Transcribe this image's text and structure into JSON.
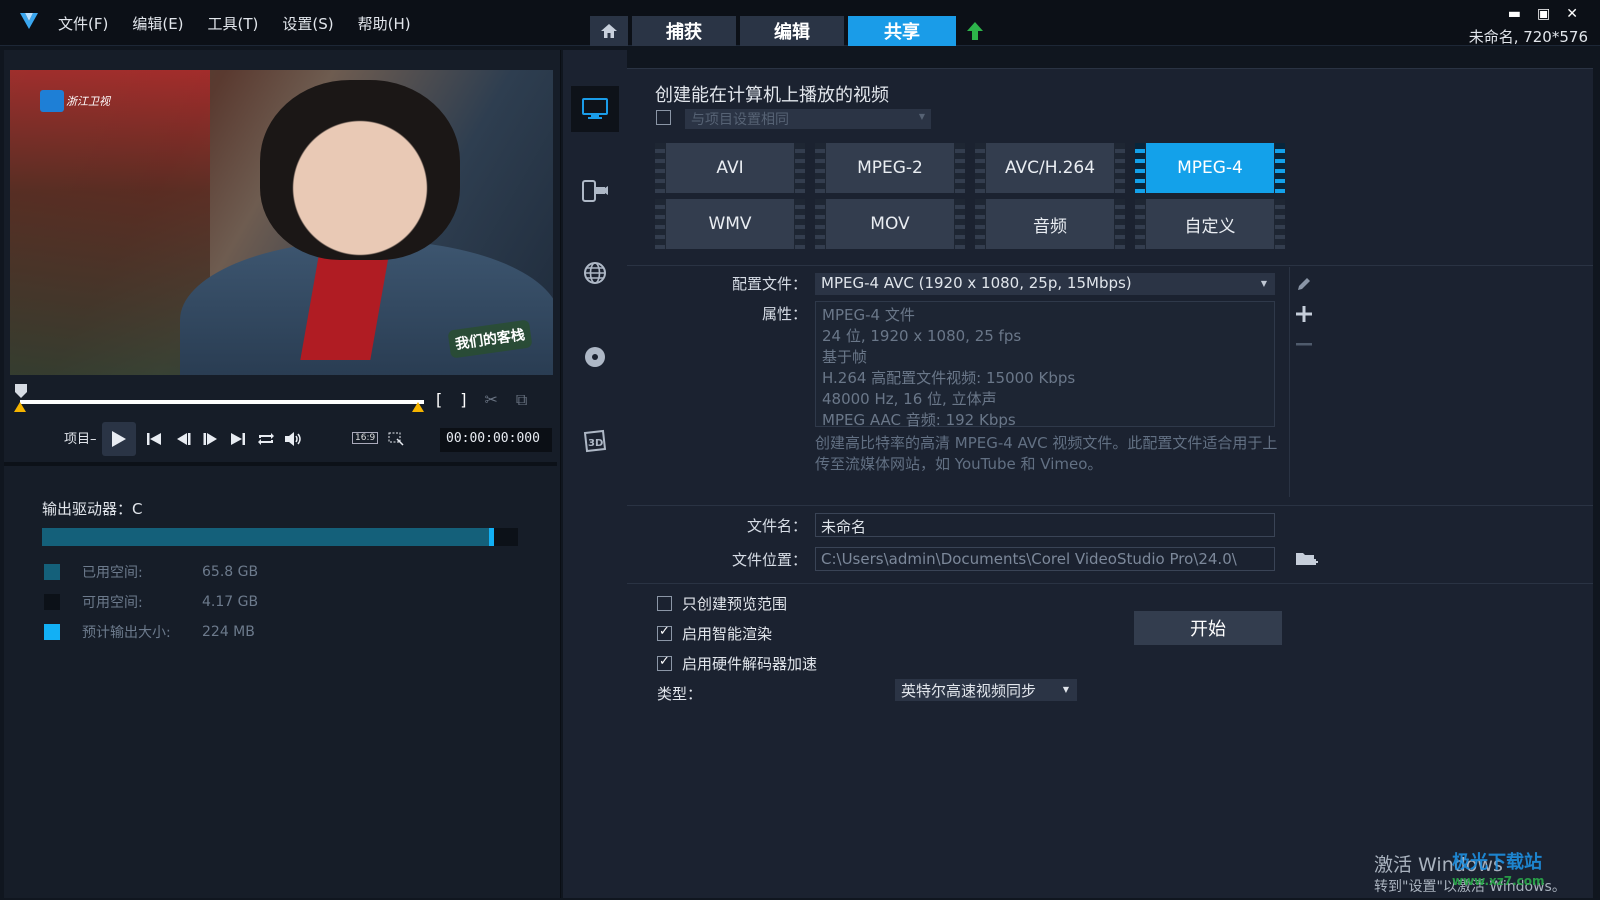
{
  "app": {
    "menu": [
      "文件(F)",
      "编辑(E)",
      "工具(T)",
      "设置(S)",
      "帮助(H)"
    ],
    "tabs": {
      "capture": "捕获",
      "edit": "编辑",
      "share": "共享"
    },
    "project_info": "未命名, 720*576",
    "accent_color": "#13a1ea"
  },
  "player": {
    "channel_logo": "浙江卫视",
    "show_logo": "我们的客栈",
    "project_label": "项目–",
    "aspect_ratio": "16:9",
    "timecode": "00:00:00:000",
    "mark_in": "[",
    "mark_out": "]"
  },
  "drive": {
    "label": "输出驱动器：C",
    "used_fraction": 0.94,
    "estimate_fraction": 0.01,
    "legend": [
      {
        "key": "已用空间:",
        "value": "65.8 GB",
        "color": "#14607a"
      },
      {
        "key": "可用空间:",
        "value": "4.17 GB",
        "color": "#0c1118"
      },
      {
        "key": "预计输出大小:",
        "value": "224 MB",
        "color": "#12b0f5"
      }
    ]
  },
  "share": {
    "heading": "创建能在计算机上播放的视频",
    "same_as_project": "与项目设置相同",
    "formats_row1": [
      "AVI",
      "MPEG-2",
      "AVC/H.264",
      "MPEG-4"
    ],
    "formats_row2": [
      "WMV",
      "MOV",
      "音频",
      "自定义"
    ],
    "selected_format": "MPEG-4",
    "profile_label": "配置文件：",
    "profile_value": "MPEG-4 AVC (1920 x 1080, 25p, 15Mbps)",
    "props_label": "属性：",
    "properties": [
      "MPEG-4 文件",
      "24 位, 1920 x 1080, 25 fps",
      "基于帧",
      "H.264 高配置文件视频: 15000 Kbps",
      "48000 Hz, 16 位, 立体声",
      "MPEG AAC 音频: 192 Kbps"
    ],
    "description": "创建高比特率的高清 MPEG-4 AVC 视频文件。此配置文件适合用于上传至流媒体网站，如 YouTube 和 Vimeo。",
    "filename_label": "文件名：",
    "filename_value": "未命名",
    "location_label": "文件位置：",
    "location_value": "C:\\Users\\admin\\Documents\\Corel VideoStudio Pro\\24.0\\",
    "options": [
      {
        "label": "只创建预览范围",
        "checked": false
      },
      {
        "label": "启用智能渲染",
        "checked": true
      },
      {
        "label": "启用硬件解码器加速",
        "checked": true
      }
    ],
    "start_label": "开始",
    "type_label": "类型：",
    "type_value": "英特尔高速视频同步"
  },
  "os": {
    "activate_line1": "激活 Windows",
    "activate_line2": "转到\"设置\"以激活 Windows。",
    "watermark": "极光下载站",
    "watermark_url": "www.xz7.com"
  }
}
